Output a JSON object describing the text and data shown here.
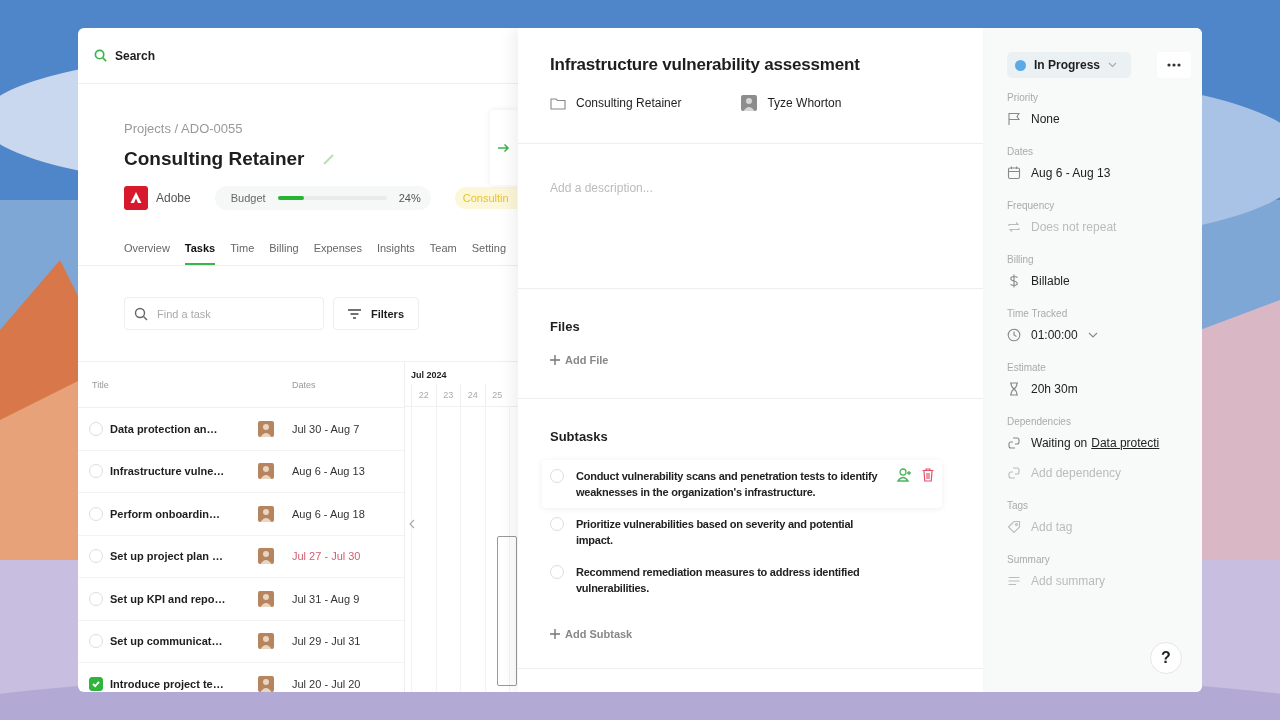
{
  "search": {
    "label": "Search"
  },
  "project": {
    "breadcrumb": "Projects / ADO-0055",
    "title": "Consulting Retainer",
    "client": "Adobe",
    "budget": {
      "label": "Budget",
      "level": 0.24,
      "reading": "24%"
    },
    "tag": "Consultin"
  },
  "tabs": [
    {
      "label": "Overview",
      "selected": false
    },
    {
      "label": "Tasks",
      "selected": true
    },
    {
      "label": "Time",
      "selected": false
    },
    {
      "label": "Billing",
      "selected": false
    },
    {
      "label": "Expenses",
      "selected": false
    },
    {
      "label": "Insights",
      "selected": false
    },
    {
      "label": "Team",
      "selected": false
    },
    {
      "label": "Setting",
      "selected": false
    }
  ],
  "task_search": {
    "placeholder": "Find a task"
  },
  "filters": "Filters",
  "table": {
    "columns": [
      "Title",
      "Dates"
    ],
    "rows": [
      {
        "title": "Data protection an…",
        "dates": "Jul 30 - Aug 7",
        "checked": false,
        "overdue": false
      },
      {
        "title": "Infrastructure vulne…",
        "dates": "Aug 6 - Aug 13",
        "checked": false,
        "overdue": false
      },
      {
        "title": "Perform onboardin…",
        "dates": "Aug 6 - Aug 18",
        "checked": false,
        "overdue": false
      },
      {
        "title": "Set up project plan …",
        "dates": "Jul 27 - Jul 30",
        "checked": false,
        "overdue": true
      },
      {
        "title": "Set up KPI and repo…",
        "dates": "Jul 31 - Aug 9",
        "checked": false,
        "overdue": false
      },
      {
        "title": "Set up communicat…",
        "dates": "Jul 29 - Jul 31",
        "checked": false,
        "overdue": false
      },
      {
        "title": "Introduce project te…",
        "dates": "Jul 20 - Jul 20",
        "checked": true,
        "overdue": false
      }
    ]
  },
  "timeline": {
    "month": "Jul 2024",
    "days": [
      "22",
      "23",
      "24",
      "25"
    ]
  },
  "detail": {
    "title": "Infrastructure vulnerability assessment",
    "project": "Consulting Retainer",
    "assignee": "Tyze Whorton",
    "description": {
      "placeholder": "Add a description..."
    },
    "files": {
      "heading": "Files",
      "add": "Add File"
    },
    "subtasks": {
      "heading": "Subtasks",
      "add": "Add Subtask",
      "items": [
        {
          "text": "Conduct vulnerability scans and penetration tests to identify weaknesses in the organization's infrastructure.",
          "checked": false,
          "hovered": true
        },
        {
          "text": "Prioritize vulnerabilities based on severity and potential impact.",
          "checked": false,
          "hovered": false
        },
        {
          "text": "Recommend remediation measures to address identified vulnerabilities.",
          "checked": false,
          "hovered": false
        }
      ]
    }
  },
  "sidebar": {
    "status": {
      "label": "In Progress",
      "color": "#5aaae8"
    },
    "fields": [
      {
        "label": "Priority",
        "rows": [
          {
            "kind": "flag",
            "text": "None",
            "muted": false
          }
        ]
      },
      {
        "label": "Dates",
        "rows": [
          {
            "kind": "calendar",
            "text": "Aug 6 - Aug 13",
            "muted": false
          }
        ]
      },
      {
        "label": "Frequency",
        "rows": [
          {
            "kind": "repeat",
            "text": "Does not repeat",
            "muted": true
          }
        ]
      },
      {
        "label": "Billing",
        "rows": [
          {
            "kind": "dollar",
            "text": "Billable",
            "muted": false
          }
        ]
      },
      {
        "label": "Time Tracked",
        "rows": [
          {
            "kind": "clock",
            "text": "01:00:00",
            "muted": false,
            "dropdown": true
          }
        ]
      },
      {
        "label": "Estimate",
        "rows": [
          {
            "kind": "hourglass",
            "text": "20h 30m",
            "muted": false
          }
        ]
      },
      {
        "label": "Dependencies",
        "rows": [
          {
            "kind": "link",
            "text": "Waiting on",
            "link": "Data protecti",
            "muted": false
          },
          {
            "kind": "link",
            "text": "Add dependency",
            "muted": true
          }
        ]
      },
      {
        "label": "Tags",
        "rows": [
          {
            "kind": "tag",
            "text": "Add tag",
            "muted": true
          }
        ]
      },
      {
        "label": "Summary",
        "rows": [
          {
            "kind": "lines",
            "text": "Add summary",
            "muted": true
          }
        ]
      }
    ]
  },
  "help": "?"
}
